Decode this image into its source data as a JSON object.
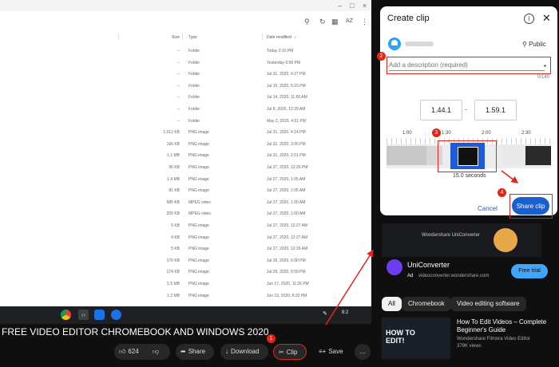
{
  "files_window": {
    "toolbar_icons": [
      "search-icon",
      "refresh-icon",
      "grid-view-icon",
      "sort-icon"
    ],
    "sort_label": "AZ",
    "columns": [
      "Size",
      "Type",
      "Date modified"
    ],
    "rows": [
      {
        "size": "--",
        "type": "Folder",
        "date": "Today 2:10 PM"
      },
      {
        "size": "--",
        "type": "Folder",
        "date": "Yesterday 6:56 PM"
      },
      {
        "size": "--",
        "type": "Folder",
        "date": "Jul 31, 2020, 4:27 PM"
      },
      {
        "size": "--",
        "type": "Folder",
        "date": "Jul 15, 2020, 5:15 PM"
      },
      {
        "size": "--",
        "type": "Folder",
        "date": "Jul 14, 2020, 11:50 AM"
      },
      {
        "size": "--",
        "type": "Folder",
        "date": "Jul 8, 2020, 12:29 AM"
      },
      {
        "size": "--",
        "type": "Folder",
        "date": "May 2, 2020, 4:51 PM"
      },
      {
        "size": "1,012 KB",
        "type": "PNG image",
        "date": "Jul 31, 2020, 4:14 PM"
      },
      {
        "size": "166 KB",
        "type": "PNG image",
        "date": "Jul 31, 2020, 3:05 PM"
      },
      {
        "size": "1.1 MB",
        "type": "PNG image",
        "date": "Jul 31, 2020, 2:51 PM"
      },
      {
        "size": "96 KB",
        "type": "PNG image",
        "date": "Jul 27, 2020, 12:26 PM"
      },
      {
        "size": "1.4 MB",
        "type": "PNG image",
        "date": "Jul 27, 2020, 1:05 AM"
      },
      {
        "size": "81 KB",
        "type": "PNG image",
        "date": "Jul 27, 2020, 1:05 AM"
      },
      {
        "size": "685 KB",
        "type": "MPEG video",
        "date": "Jul 27, 2020, 1:00 AM"
      },
      {
        "size": "205 KB",
        "type": "MPEG video",
        "date": "Jul 27, 2020, 1:00 AM"
      },
      {
        "size": "5 KB",
        "type": "PNG image",
        "date": "Jul 27, 2020, 12:27 AM"
      },
      {
        "size": "4 KB",
        "type": "PNG image",
        "date": "Jul 27, 2020, 12:27 AM"
      },
      {
        "size": "5 KB",
        "type": "PNG image",
        "date": "Jul 27, 2020, 12:26 AM"
      },
      {
        "size": "170 KB",
        "type": "PNG image",
        "date": "Jul 26, 2020, 6:00 PM"
      },
      {
        "size": "174 KB",
        "type": "PNG image",
        "date": "Jul 26, 2020, 5:59 PM"
      },
      {
        "size": "1.5 MB",
        "type": "PNG image",
        "date": "Jun 17, 2020, 11:26 PM"
      },
      {
        "size": "1.2 MB",
        "type": "PNG image",
        "date": "Jun 13, 2020, 8:20 PM"
      }
    ]
  },
  "taskbar": {
    "apps": [
      "chrome-icon",
      "code-icon",
      "files-icon",
      "settings-icon"
    ],
    "tray_text": "8:2"
  },
  "video": {
    "title": "FREE VIDEO EDITOR CHROMEBOOK AND WINDOWS 2020",
    "likes": "624",
    "share_label": "Share",
    "download_label": "Download",
    "clip_label": "Clip",
    "save_label": "Save",
    "more_label": "..."
  },
  "dialog": {
    "title": "Create clip",
    "visibility": "Public",
    "description_placeholder": "Add a description (required)",
    "char_counter": "0/140",
    "start_time": "1.44.1",
    "end_time": "1.59.1",
    "separator": "-",
    "ticks": [
      "1:00",
      "1:30",
      "2:00",
      "2:30"
    ],
    "duration": "15.0 seconds",
    "cancel_label": "Cancel",
    "share_label": "Share clip"
  },
  "markers": [
    "1",
    "2",
    "3",
    "4"
  ],
  "sidebar": {
    "banner_text": "Wondershare UniConverter",
    "ad_name": "UniConverter",
    "ad_badge": "Ad",
    "ad_url": "videoconverter.wondershare.com",
    "ad_cta": "Free trial",
    "chips": [
      "All",
      "Chromebook",
      "Video editing software"
    ],
    "rec_title": "How To Edit Videos – Complete Beginner's Guide",
    "rec_channel": "Wondershare Filmora Video Editor",
    "rec_views": "379K views",
    "thumb_text": "HOW TO EDIT!"
  },
  "colors": {
    "annotation_red": "#e0261b",
    "primary_blue": "#1a5fd0",
    "clip_selection": "#1f5ad8"
  }
}
